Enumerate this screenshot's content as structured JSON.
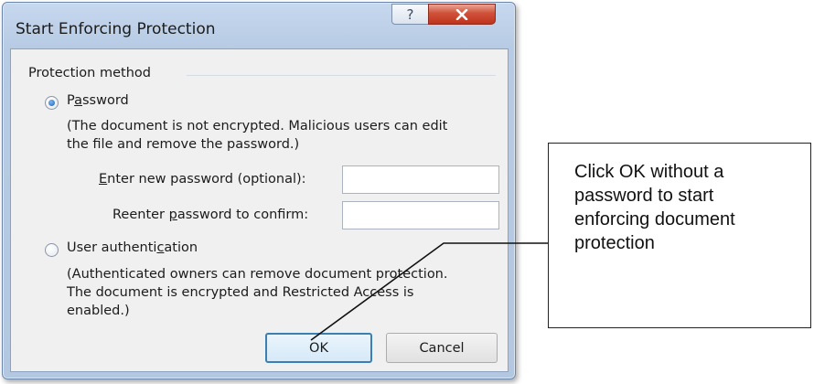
{
  "dialog": {
    "title": "Start Enforcing Protection",
    "help_icon": "question-mark-icon",
    "close_icon": "close-x-icon",
    "group_label": "Protection method",
    "options": [
      {
        "label_parts": [
          "P",
          "a",
          "ssword"
        ],
        "selected": true,
        "description_lines": [
          "(The document is not encrypted. Malicious users can edit",
          "the file and remove the password.)"
        ]
      },
      {
        "label_parts": [
          "User authenti",
          "c",
          "ation"
        ],
        "selected": false,
        "description_lines": [
          "(Authenticated owners can remove document protection.",
          "The document is encrypted and Restricted Access is",
          "enabled.)"
        ]
      }
    ],
    "new_password_label_parts": [
      "",
      "E",
      "nter new password (optional):"
    ],
    "confirm_password_label_parts": [
      "Reenter ",
      "p",
      "assword to confirm:"
    ],
    "new_password_value": "",
    "confirm_password_value": "",
    "ok_label": "OK",
    "cancel_label": "Cancel"
  },
  "callout": {
    "lines": [
      "Click OK without a",
      "password to start",
      "enforcing document",
      "protection"
    ]
  }
}
